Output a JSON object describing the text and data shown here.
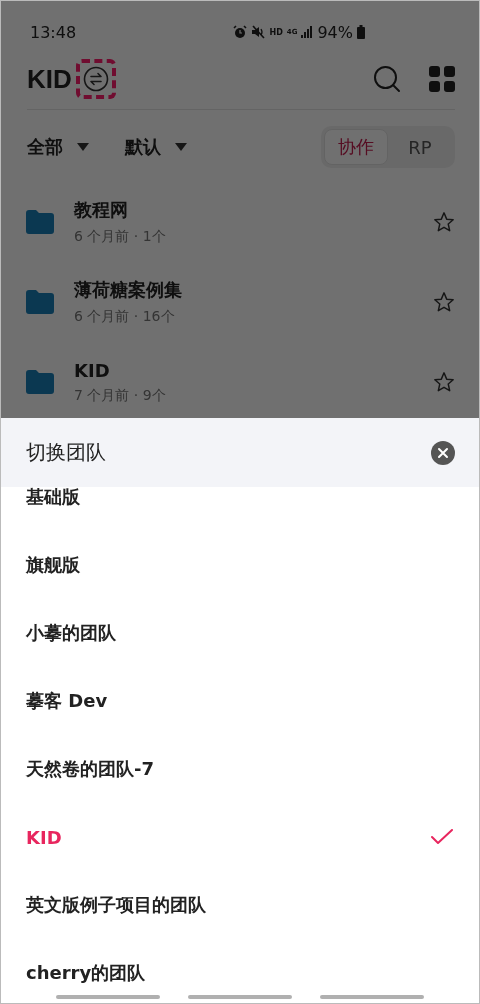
{
  "status_bar": {
    "time": "13:48",
    "hd": "HD",
    "network": "4G",
    "battery": "94%"
  },
  "header": {
    "title": "KID"
  },
  "filters": [
    {
      "label": "全部"
    },
    {
      "label": "默认"
    }
  ],
  "segments": [
    {
      "label": "协作",
      "selected": true
    },
    {
      "label": "RP",
      "selected": false
    }
  ],
  "folders": [
    {
      "name": "教程网",
      "meta": "6 个月前 · 1个",
      "starred": false
    },
    {
      "name": "薄荷糖案例集",
      "meta": "6 个月前 · 16个",
      "starred": false
    },
    {
      "name": "KID",
      "meta": "7 个月前 · 9个",
      "starred": false
    }
  ],
  "sheet": {
    "title": "切换团队",
    "teams": [
      {
        "name": "基础版",
        "selected": false
      },
      {
        "name": "旗舰版",
        "selected": false
      },
      {
        "name": "小摹的团队",
        "selected": false
      },
      {
        "name": "摹客 Dev",
        "selected": false
      },
      {
        "name": "天然卷的团队-7",
        "selected": false
      },
      {
        "name": "KID",
        "selected": true
      },
      {
        "name": "英文版例子项目的团队",
        "selected": false
      },
      {
        "name": "cherry的团队",
        "selected": false
      }
    ]
  }
}
